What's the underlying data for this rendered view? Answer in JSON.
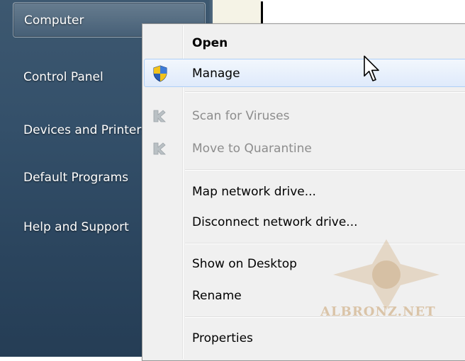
{
  "start_menu": {
    "items": [
      {
        "label": "Computer"
      },
      {
        "label": "Control Panel"
      },
      {
        "label": "Devices and Printers"
      },
      {
        "label": "Default Programs"
      },
      {
        "label": "Help and Support"
      }
    ]
  },
  "context_menu": {
    "items": [
      {
        "label": "Open",
        "style": "default"
      },
      {
        "label": "Manage",
        "icon": "uac-shield-icon",
        "state": "hover"
      },
      {
        "label": "Scan for Viruses",
        "icon": "antivirus-icon",
        "state": "disabled"
      },
      {
        "label": "Move to Quarantine",
        "icon": "antivirus-icon",
        "state": "disabled"
      },
      {
        "label": "Map network drive..."
      },
      {
        "label": "Disconnect network drive..."
      },
      {
        "label": "Show on Desktop"
      },
      {
        "label": "Rename"
      },
      {
        "label": "Properties"
      }
    ]
  },
  "watermark": {
    "text": "ALBRONZ.NET"
  },
  "colors": {
    "start_pane": "#34506a",
    "menu_bg": "#f0f0f0",
    "hover_border": "#aecff7",
    "disabled_text": "#8d8d8d"
  }
}
